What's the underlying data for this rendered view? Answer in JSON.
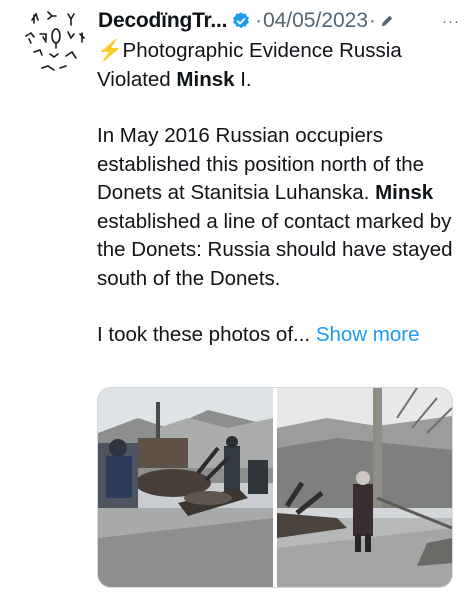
{
  "author": {
    "display_name": "DecodïngTr...",
    "verified_icon": "verified-badge-icon",
    "separator": "·",
    "date": "04/05/2023",
    "edited_icon": "pencil-icon",
    "more_label": "···"
  },
  "tweet": {
    "bolt": "⚡",
    "line1_a": "Photographic Evidence Russia Violated ",
    "line1_bold": "Minsk",
    "line1_b": " I.",
    "para2": "In May 2016 Russian occupiers established this position north of the Donets at Stanitsia Luhanska.",
    "para2b_bold": "Minsk",
    "para2b": " established a line of contact marked by the Donets: Russia should have stayed south of the Donets.",
    "para3": "I took these photos of...",
    "show_more": "Show more"
  },
  "media": {
    "photo_left": "photo-checkpoint-left",
    "photo_right": "photo-checkpoint-right"
  },
  "colors": {
    "text": "#0f1419",
    "muted": "#536471",
    "link": "#1d9bf0",
    "bolt": "#f5b800"
  }
}
